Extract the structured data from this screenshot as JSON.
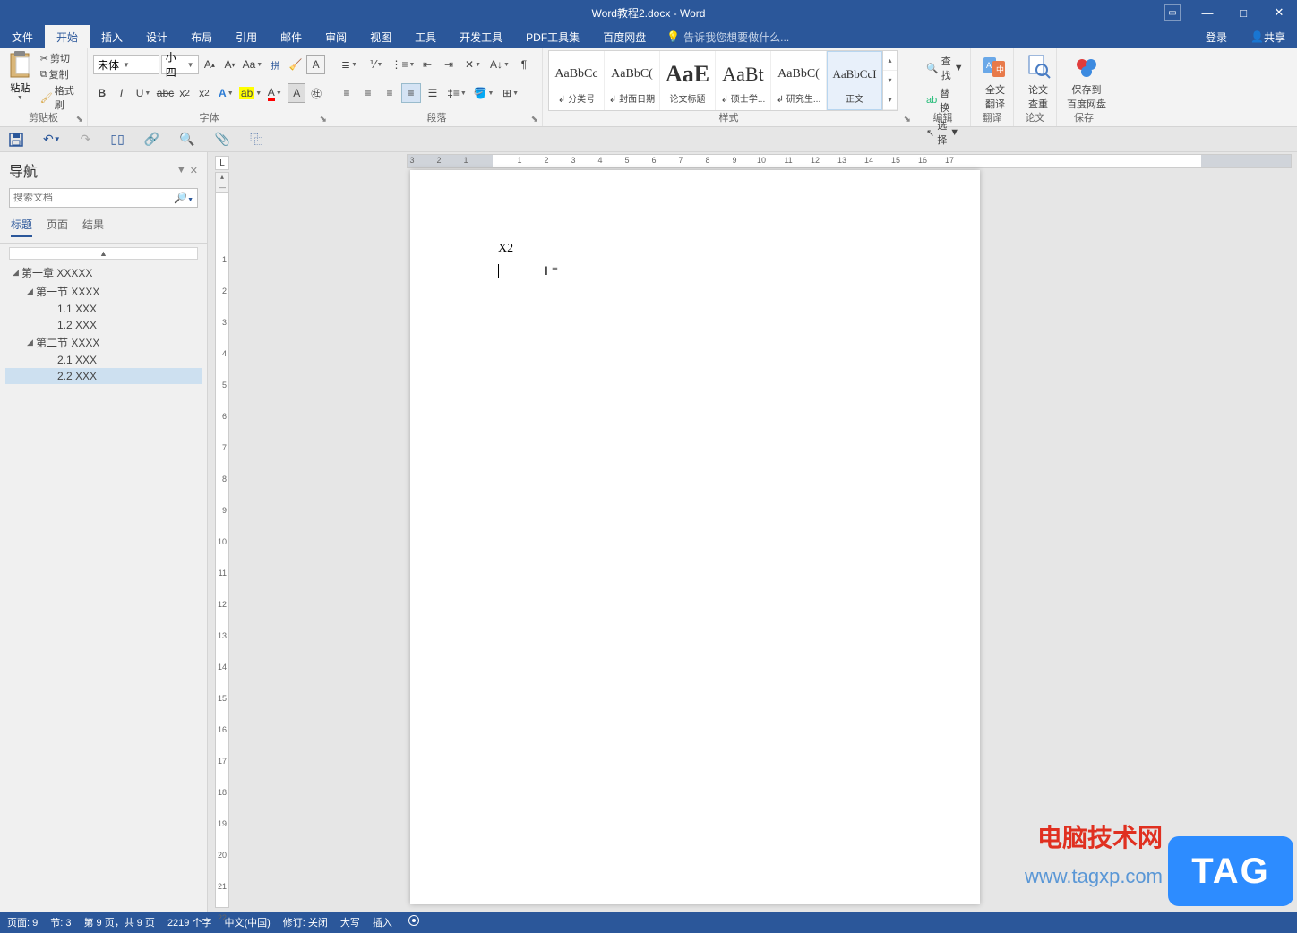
{
  "title": "Word教程2.docx - Word",
  "menu": {
    "file": "文件",
    "home": "开始",
    "insert": "插入",
    "design": "设计",
    "layout": "布局",
    "ref": "引用",
    "mail": "邮件",
    "review": "审阅",
    "view": "视图",
    "tool": "工具",
    "dev": "开发工具",
    "pdf": "PDF工具集",
    "baidu": "百度网盘",
    "tellme": "告诉我您想要做什么...",
    "login": "登录",
    "share": "共享"
  },
  "clipboard": {
    "paste": "粘贴",
    "cut": "剪切",
    "copy": "复制",
    "painter": "格式刷",
    "label": "剪贴板"
  },
  "font": {
    "name": "宋体",
    "size": "小四",
    "label": "字体"
  },
  "para": {
    "label": "段落"
  },
  "styles": {
    "label": "样式",
    "items": [
      {
        "prev": "AaBbCc",
        "name": "↲ 分类号",
        "size": "14px"
      },
      {
        "prev": "AaBbC(",
        "name": "↲ 封面日期",
        "size": "14px"
      },
      {
        "prev": "AaE",
        "name": "论文标题",
        "size": "26px",
        "bold": true
      },
      {
        "prev": "AaBt",
        "name": "↲ 硕士学...",
        "size": "22px"
      },
      {
        "prev": "AaBbC(",
        "name": "↲ 研究生...",
        "size": "14px"
      },
      {
        "prev": "AaBbCcI",
        "name": "正文",
        "size": "13px",
        "sel": true
      }
    ]
  },
  "edit": {
    "find": "查找",
    "replace": "替换",
    "select": "选择",
    "label": "编辑"
  },
  "trans": {
    "full": "全文\n翻译",
    "label": "翻译"
  },
  "thesis": {
    "btn": "论文\n查重",
    "label": "论文"
  },
  "save": {
    "btn": "保存到\n百度网盘",
    "label": "保存"
  },
  "nav": {
    "title": "导航",
    "searchPH": "搜索文档",
    "tabs": {
      "headings": "标题",
      "pages": "页面",
      "results": "结果"
    },
    "tree": [
      {
        "level": 1,
        "exp": true,
        "text": "第一章 XXXXX"
      },
      {
        "level": 2,
        "exp": true,
        "text": "第一节 XXXX"
      },
      {
        "level": 3,
        "text": "1.1 XXX"
      },
      {
        "level": 3,
        "text": "1.2 XXX"
      },
      {
        "level": 2,
        "exp": true,
        "text": "第二节 XXXX"
      },
      {
        "level": 3,
        "text": "2.1 XXX"
      },
      {
        "level": 3,
        "text": "2.2 XXX",
        "sel": true
      }
    ]
  },
  "doc": {
    "text": "X2"
  },
  "status": {
    "page": "页面: 9",
    "sec": "节: 3",
    "pages": "第 9 页，共 9 页",
    "words": "2219 个字",
    "lang": "中文(中国)",
    "track": "修订: 关闭",
    "caps": "大写",
    "ins": "插入"
  },
  "watermark": {
    "site": "电脑技术网",
    "url": "www.tagxp.com",
    "tag": "TAG"
  }
}
